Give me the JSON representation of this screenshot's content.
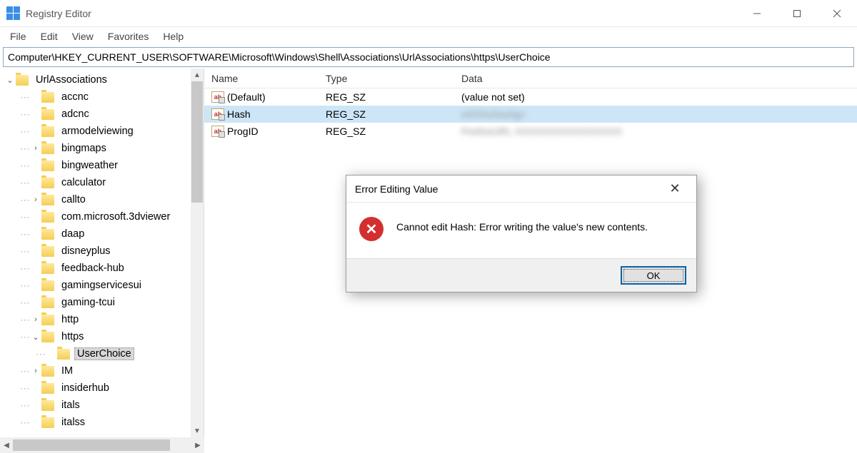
{
  "window": {
    "title": "Registry Editor",
    "menu": [
      "File",
      "Edit",
      "View",
      "Favorites",
      "Help"
    ],
    "address": "Computer\\HKEY_CURRENT_USER\\SOFTWARE\\Microsoft\\Windows\\Shell\\Associations\\UrlAssociations\\https\\UserChoice"
  },
  "tree": {
    "root": "UrlAssociations",
    "items": [
      {
        "label": "accnc",
        "depth": 1,
        "chev": ""
      },
      {
        "label": "adcnc",
        "depth": 1,
        "chev": ""
      },
      {
        "label": "armodelviewing",
        "depth": 1,
        "chev": ""
      },
      {
        "label": "bingmaps",
        "depth": 1,
        "chev": ">"
      },
      {
        "label": "bingweather",
        "depth": 1,
        "chev": ""
      },
      {
        "label": "calculator",
        "depth": 1,
        "chev": ""
      },
      {
        "label": "callto",
        "depth": 1,
        "chev": ">"
      },
      {
        "label": "com.microsoft.3dviewer",
        "depth": 1,
        "chev": ""
      },
      {
        "label": "daap",
        "depth": 1,
        "chev": ""
      },
      {
        "label": "disneyplus",
        "depth": 1,
        "chev": ""
      },
      {
        "label": "feedback-hub",
        "depth": 1,
        "chev": ""
      },
      {
        "label": "gamingservicesui",
        "depth": 1,
        "chev": ""
      },
      {
        "label": "gaming-tcui",
        "depth": 1,
        "chev": ""
      },
      {
        "label": "http",
        "depth": 1,
        "chev": ">"
      },
      {
        "label": "https",
        "depth": 1,
        "chev": "v"
      },
      {
        "label": "UserChoice",
        "depth": 2,
        "chev": "",
        "selected": true
      },
      {
        "label": "IM",
        "depth": 1,
        "chev": ">"
      },
      {
        "label": "insiderhub",
        "depth": 1,
        "chev": ""
      },
      {
        "label": "itals",
        "depth": 1,
        "chev": ""
      },
      {
        "label": "italss",
        "depth": 1,
        "chev": ""
      }
    ]
  },
  "list": {
    "headers": {
      "name": "Name",
      "type": "Type",
      "data": "Data"
    },
    "rows": [
      {
        "name": "(Default)",
        "type": "REG_SZ",
        "data": "(value not set)",
        "selected": false,
        "blur": false
      },
      {
        "name": "Hash",
        "type": "REG_SZ",
        "data": "xXXXxXxxXg=",
        "selected": true,
        "blur": true
      },
      {
        "name": "ProgID",
        "type": "REG_SZ",
        "data": "FirefoxURL-XXXXXXXXXXXXXXXX",
        "selected": false,
        "blur": true
      }
    ]
  },
  "dialog": {
    "title": "Error Editing Value",
    "message": "Cannot edit Hash:  Error writing the value's new contents.",
    "ok": "OK"
  }
}
